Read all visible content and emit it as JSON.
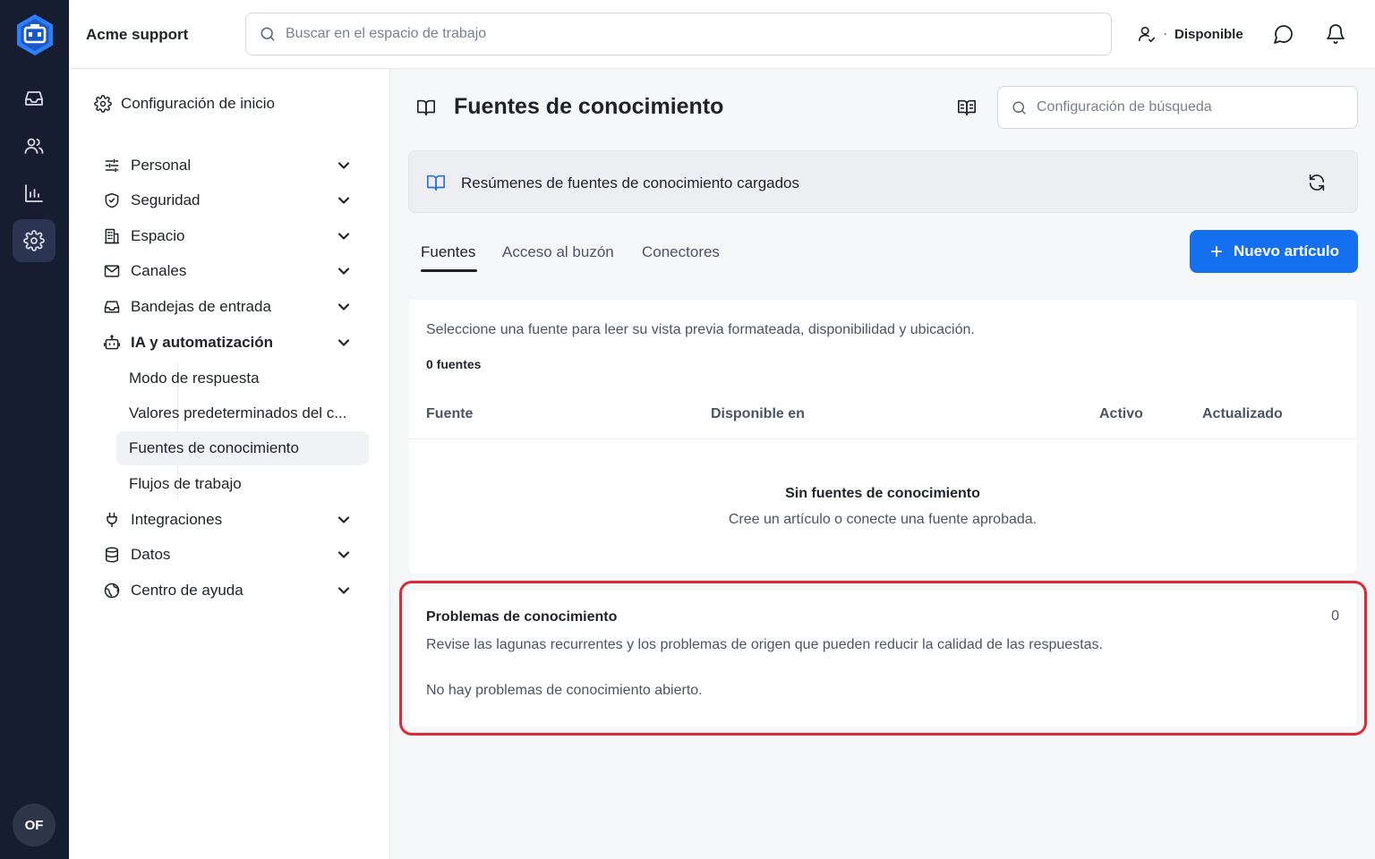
{
  "topbar": {
    "workspace": "Acme support",
    "search_placeholder": "Buscar en el espacio de trabajo",
    "status_separator": "·",
    "status_label": "Disponible"
  },
  "rail": {
    "items": [
      {
        "icon": "inbox-icon",
        "active": false
      },
      {
        "icon": "users-icon",
        "active": false
      },
      {
        "icon": "bar-chart-icon",
        "active": false
      },
      {
        "icon": "gear-icon",
        "active": true
      }
    ],
    "avatar_initials": "OF"
  },
  "settings_nav": {
    "home_label": "Configuración de inicio",
    "items": [
      {
        "label": "Personal",
        "icon": "sliders-icon"
      },
      {
        "label": "Seguridad",
        "icon": "shield-icon"
      },
      {
        "label": "Espacio",
        "icon": "building-icon"
      },
      {
        "label": "Canales",
        "icon": "mail-icon"
      },
      {
        "label": "Bandejas de entrada",
        "icon": "inbox-icon"
      },
      {
        "label": "IA y automatización",
        "icon": "robot-icon",
        "expanded": true
      },
      {
        "label": "Integraciones",
        "icon": "plug-icon"
      },
      {
        "label": "Datos",
        "icon": "database-icon"
      },
      {
        "label": "Centro de ayuda",
        "icon": "globe-icon"
      }
    ],
    "subitems": [
      {
        "label": "Modo de respuesta"
      },
      {
        "label": "Valores predeterminados del c..."
      },
      {
        "label": "Fuentes de conocimiento",
        "active": true
      },
      {
        "label": "Flujos de trabajo"
      }
    ]
  },
  "page": {
    "title": "Fuentes de conocimiento",
    "local_search_placeholder": "Configuración de búsqueda",
    "banner_text": "Resúmenes de fuentes de conocimiento cargados",
    "tabs": [
      {
        "label": "Fuentes",
        "active": true
      },
      {
        "label": "Acceso al buzón"
      },
      {
        "label": "Conectores"
      }
    ],
    "new_button": "Nuevo artículo"
  },
  "sources": {
    "intro": "Seleccione una fuente para leer su vista previa formateada, disponibilidad y ubicación.",
    "count": "0 fuentes",
    "columns": [
      "Fuente",
      "Disponible en",
      "Activo",
      "Actualizado"
    ],
    "empty_title": "Sin fuentes de conocimiento",
    "empty_sub": "Cree un artículo o conecte una fuente aprobada."
  },
  "issues": {
    "title": "Problemas de conocimiento",
    "count": "0",
    "description": "Revise las lagunas recurrentes y los problemas de origen que pueden reducir la calidad de las respuestas.",
    "empty": "No hay problemas de conocimiento abierto."
  },
  "colors": {
    "rail_bg": "#161d31",
    "accent": "#1570ef",
    "highlight": "#dc2b36"
  }
}
